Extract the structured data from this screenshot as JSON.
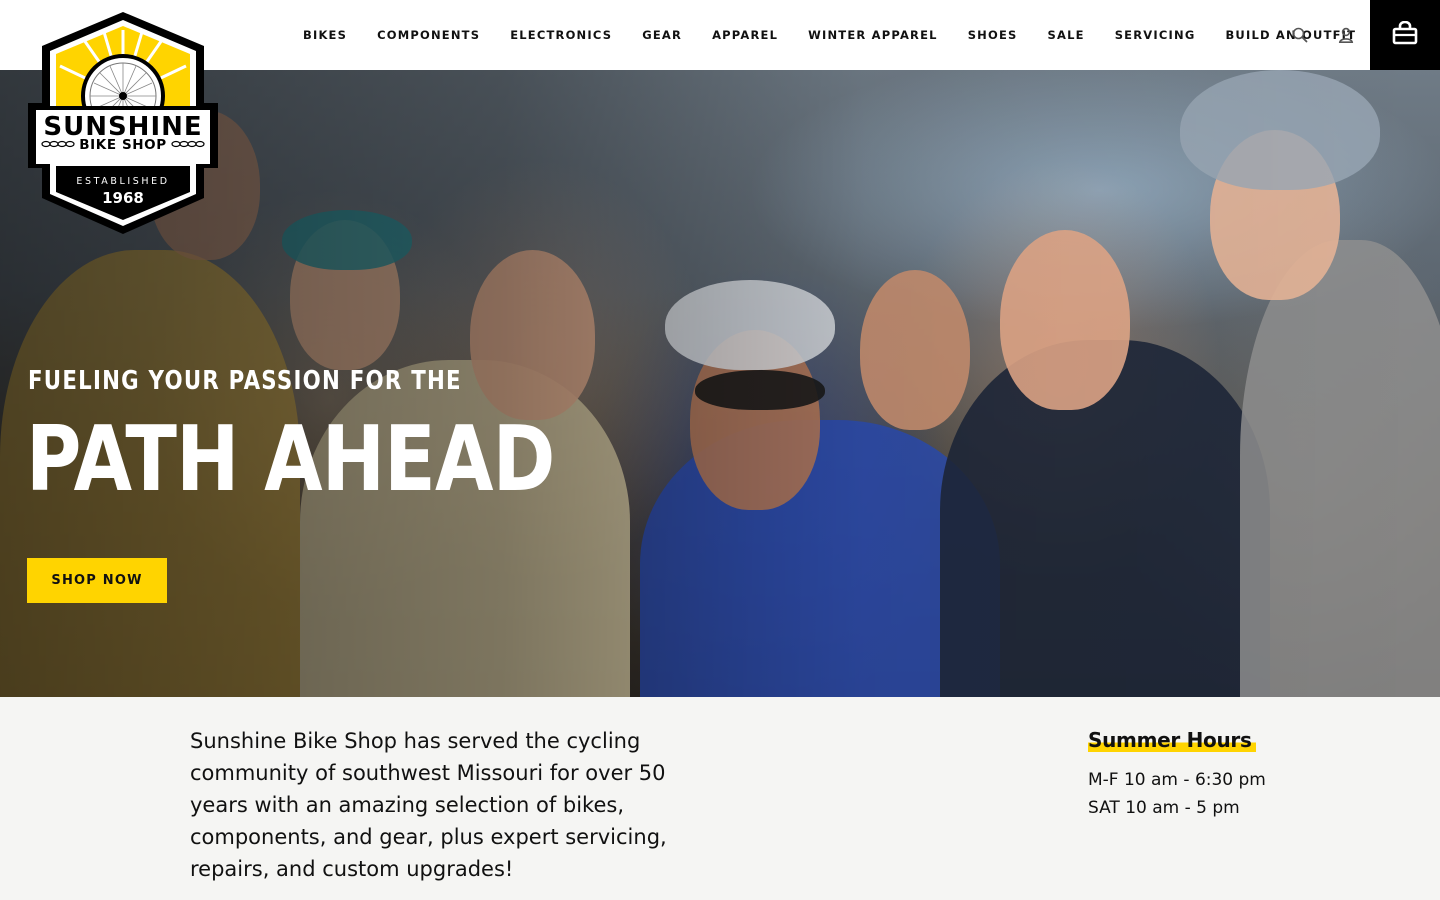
{
  "brand": {
    "name": "SUNSHINE",
    "subname": "BIKE SHOP",
    "established_label": "ESTABLISHED",
    "year": "1968",
    "colors": {
      "yellow": "#ffd400",
      "black": "#000000",
      "white": "#ffffff"
    }
  },
  "nav": {
    "items": [
      {
        "label": "BIKES"
      },
      {
        "label": "COMPONENTS"
      },
      {
        "label": "ELECTRONICS"
      },
      {
        "label": "GEAR"
      },
      {
        "label": "APPAREL"
      },
      {
        "label": "WINTER APPAREL"
      },
      {
        "label": "SHOES"
      },
      {
        "label": "SALE"
      },
      {
        "label": "SERVICING"
      },
      {
        "label": "BUILD AN OUTFIT"
      }
    ],
    "icons": [
      "search-icon",
      "account-icon",
      "cart-icon"
    ]
  },
  "hero": {
    "kicker": "FUELING YOUR PASSION FOR THE",
    "title": "PATH AHEAD",
    "cta_label": "SHOP NOW"
  },
  "intro": {
    "text": "Sunshine Bike Shop has served the cycling community of southwest Missouri for over 50 years with an amazing selection of bikes, components, and gear, plus expert servicing, repairs, and custom upgrades!"
  },
  "hours": {
    "title": "Summer Hours",
    "lines": [
      "M-F 10 am - 6:30 pm",
      "SAT 10 am - 5 pm"
    ]
  }
}
